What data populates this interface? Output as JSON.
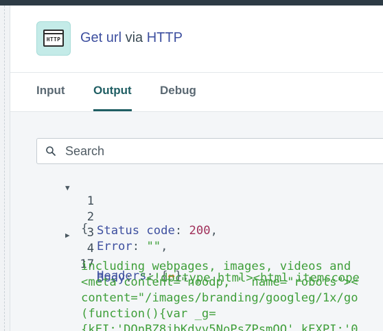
{
  "header": {
    "icon_text": "HTTP",
    "title_left": "Get url",
    "title_via": "via",
    "title_right": "HTTP"
  },
  "tabs": [
    {
      "label": "Input",
      "active": false
    },
    {
      "label": "Output",
      "active": true
    },
    {
      "label": "Debug",
      "active": false
    }
  ],
  "search": {
    "placeholder": "Search"
  },
  "code": {
    "lines": [
      {
        "num": "1",
        "fold": "▼",
        "open_brace": "{"
      },
      {
        "num": "2",
        "key": "Status code",
        "colon": ": ",
        "value": "200",
        "end": ","
      },
      {
        "num": "3",
        "key": "Error",
        "colon": ": ",
        "value": "\"\"",
        "end": ","
      },
      {
        "num": "4",
        "fold": "▶",
        "key": "Headers",
        "colon": ": ",
        "value_open": "{",
        "value_arrow": "↔",
        "value_close": "}",
        "end": ","
      },
      {
        "num": "17",
        "key": "Body",
        "colon": ": ",
        "value": "\"<!doctype html><html itemscope"
      }
    ],
    "wrapped": [
      "including webpages, images, videos and",
      "<meta content=\"noodp, \" name=\"robots\"><",
      "content=\"/images/branding/googleg/1x/go",
      "(function(){var _g=",
      "{kEI:'DOnBZ8jbKdyv5NoPsZPsmQQ',kEXPI:'0"
    ]
  },
  "colors": {
    "accent": "#1f5e63",
    "link": "#3d4f9f",
    "string": "#3f9f3a",
    "number": "#a0305a",
    "icon_bg": "#c4ebe8"
  }
}
